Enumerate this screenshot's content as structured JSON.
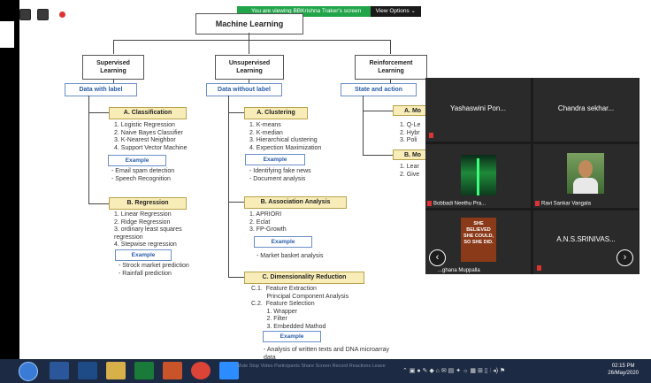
{
  "banner": {
    "message": "You are viewing BBKrishna Traker's screen",
    "options": "View Options ⌄"
  },
  "title": "Machine Learning",
  "columns": {
    "supervised": {
      "header_line1": "Supervised",
      "header_line2": "Learning",
      "tag": "Data with label",
      "a_title": "A. Classification",
      "a_items": "1. Logistic Regression\n2. Naive Bayes Classifier\n3. K-Nearest Neighbor\n4. Support Vector Machine",
      "a_example": "Example",
      "a_examples": "- Email spam detection\n- Speech Recognition",
      "b_title": "B. Regression",
      "b_items": "1. Linear Regression\n2. Ridge Regression\n3. ordinary least squares\nregression\n4. Stepwise regression",
      "b_example": "Example",
      "b_examples": "- Strock market prediction\n- Rainfall prediction"
    },
    "unsupervised": {
      "header_line1": "Unsupervised",
      "header_line2": "Learning",
      "tag": "Data without label",
      "a_title": "A. Clustering",
      "a_items": "1. K-means\n2. K-median\n3. Hierarchical clustering\n4. Expection Maximization",
      "a_example": "Example",
      "a_examples": "- Identifying fake news\n- Document analysis",
      "b_title": "B. Association Analysis",
      "b_items": "1. APRIORI\n2. Eclat\n3. FP-Growth",
      "b_example": "Example",
      "b_examples": "- Market basket analysis",
      "c_title": "C. Dimensionality Reduction",
      "c_items": "C.1.  Feature Extraction\n         Principal Component Analysis\nC.2.  Feature Selection\n         1. Wrapper\n         2. Filter\n         3. Embedded Mathod",
      "c_example": "Example",
      "c_examples": "- Analysis of written texts and DNA microarray\ndata"
    },
    "reinforcement": {
      "header_line1": "Reinforcement",
      "header_line2": "Learning",
      "tag": "State and action",
      "a_title": "A. Mo",
      "a_items": "1. Q-Le\n2. Hybr\n3. Poli",
      "b_title": "B. Mo",
      "b_items": "1. Lear\n2. Give"
    }
  },
  "participants": [
    {
      "name": "Yashaswini Pon...",
      "label": ""
    },
    {
      "name": "Chandra sekhar...",
      "label": ""
    },
    {
      "name": "",
      "label": "Bobbadi Neethu Pra..."
    },
    {
      "name": "",
      "label": "Ravi Sankar Vangala"
    },
    {
      "name": "",
      "label": "...ghana Muppalla",
      "image_text": "SHE BELIEVED SHE COULD, SO SHE DID."
    },
    {
      "name": "A.N.S.SRINIVAS...",
      "label": ""
    }
  ],
  "taskbar": {
    "dim_labels": "Mute          Stop Video        Participants       Share Screen        Record        Reactions        Leave",
    "tray": "⌃  ▣  ●  ✎  ◆  ⌂  ✉  ▤  ✦  ☼  ▦  ⊞  ▯  ⫶  ◂)  ⚑",
    "time": "02:15 PM",
    "date": "26/May/2020"
  },
  "colors": {
    "zoom_green": "#22a54a",
    "box_yellow": "#f8edb8",
    "tag_blue": "#2a5da8",
    "taskbar": "#1c2a44"
  }
}
